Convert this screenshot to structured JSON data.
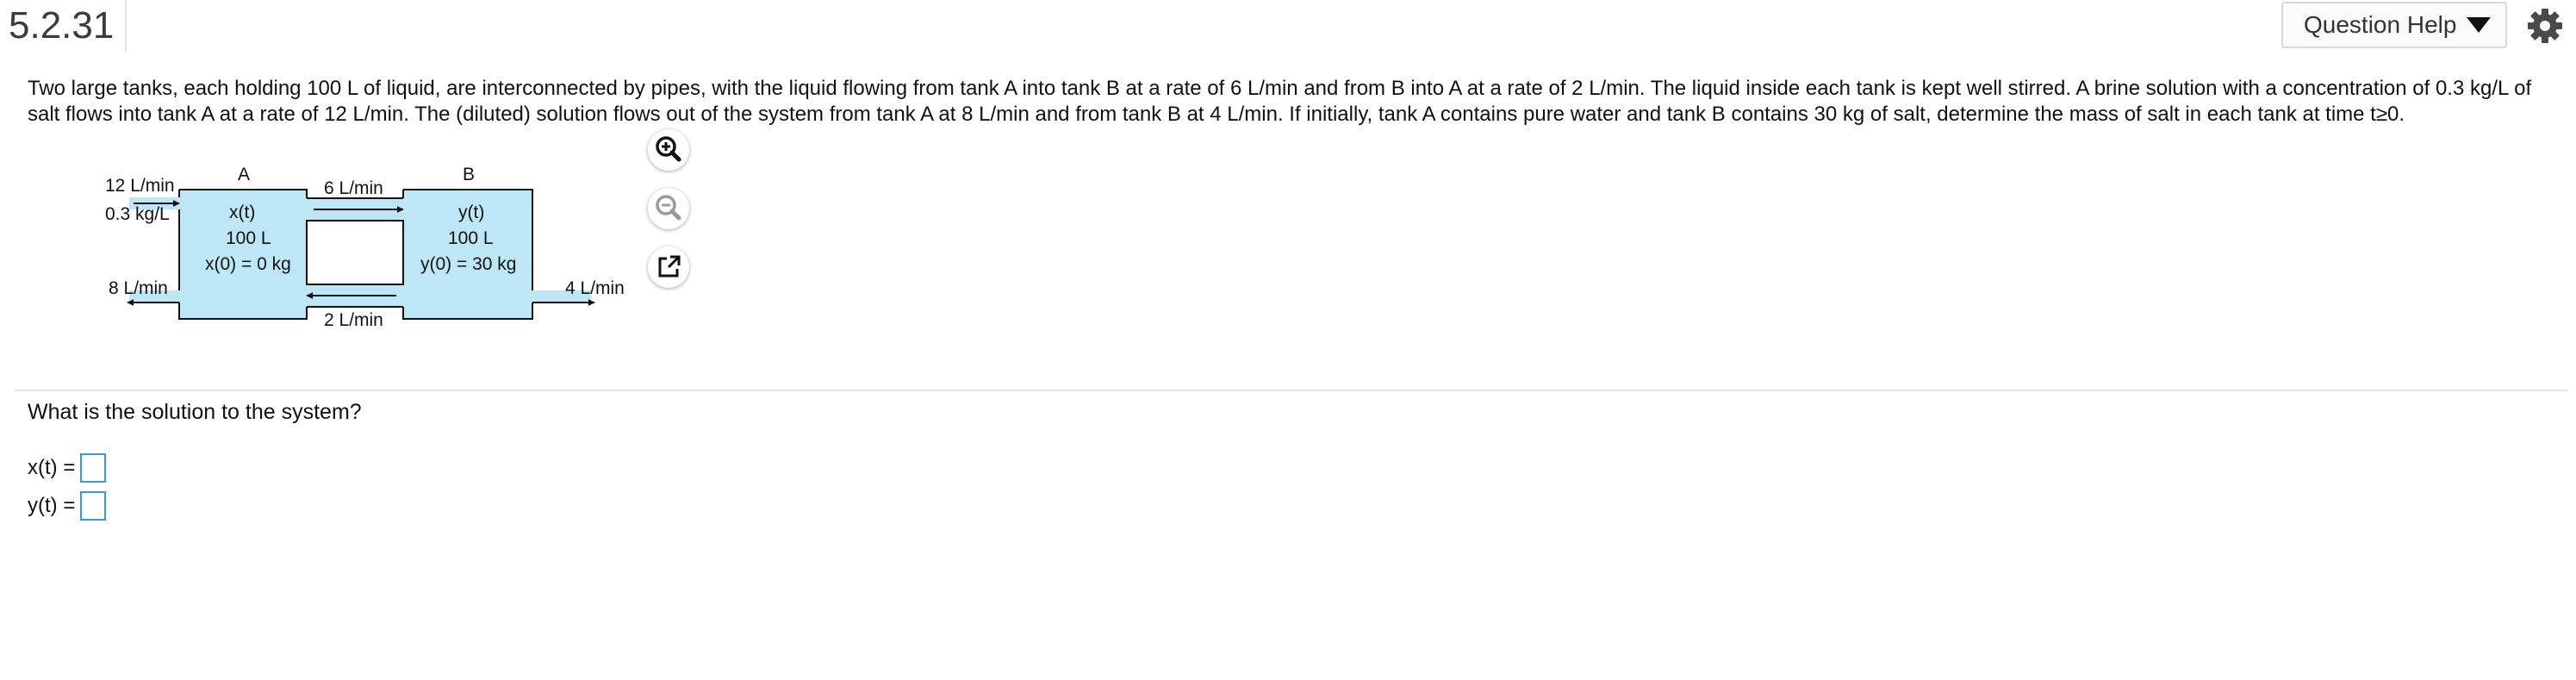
{
  "header": {
    "question_number": "5.2.31",
    "help_label": "Question Help"
  },
  "problem_text": "Two large tanks, each holding 100 L of liquid, are interconnected by pipes, with the liquid flowing from tank A into tank B at a rate of 6 L/min and from B into A at a rate of 2 L/min. The liquid inside each tank is kept well stirred. A brine solution with a concentration of 0.3 kg/L of salt flows into tank A at a rate of 12 L/min. The (diluted) solution flows out of the system from tank A at 8 L/min and from tank B at 4 L/min. If initially, tank A contains pure water and tank B contains 30 kg of salt, determine the mass of salt in each tank at time t≥0.",
  "diagram": {
    "tank_a_label": "A",
    "tank_b_label": "B",
    "inflow_rate": "12 L/min",
    "inflow_conc": "0.3 kg/L",
    "a_to_b_rate": "6 L/min",
    "b_to_a_rate": "2 L/min",
    "outflow_a": "8 L/min",
    "outflow_b": "4 L/min",
    "tank_a_var": "x(t)",
    "tank_a_vol": "100 L",
    "tank_a_init": "x(0) = 0 kg",
    "tank_b_var": "y(t)",
    "tank_b_vol": "100 L",
    "tank_b_init": "y(0) = 30 kg",
    "fill_color": "#bde6f7"
  },
  "tools": [
    "zoom-in-icon",
    "zoom-out-icon",
    "open-new-window-icon"
  ],
  "question": "What is the solution to the system?",
  "answers": [
    {
      "label": "x(t) =",
      "value": ""
    },
    {
      "label": "y(t) =",
      "value": ""
    }
  ]
}
